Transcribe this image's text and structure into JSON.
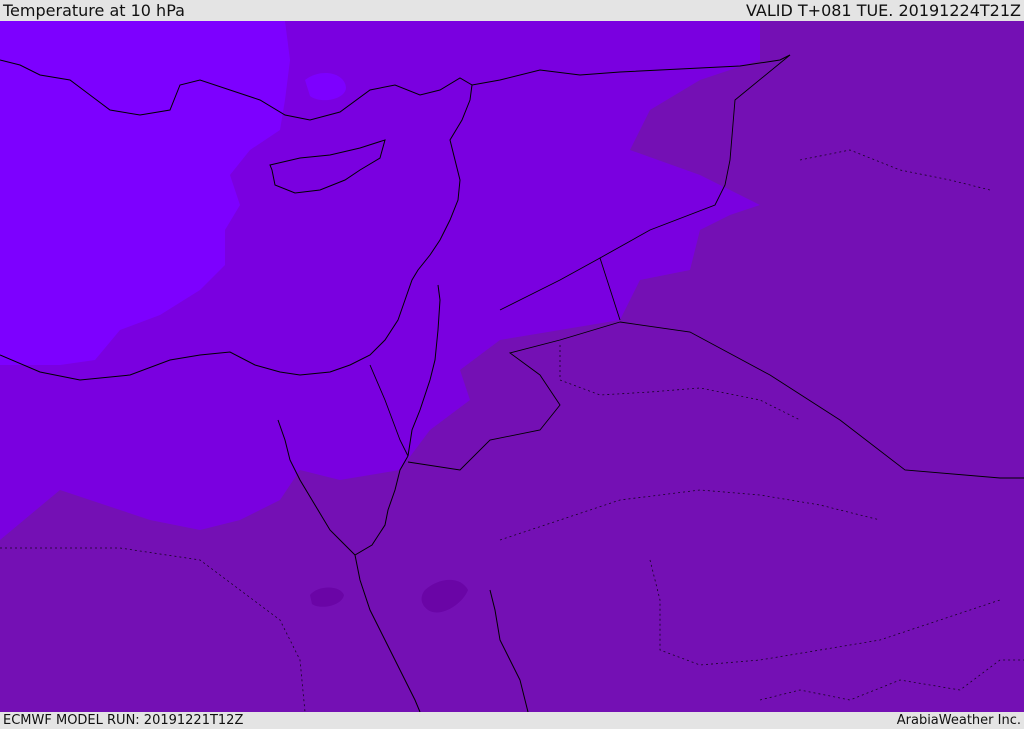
{
  "header": {
    "title": "Temperature at 10 hPa",
    "valid": "VALID T+081 TUE. 20191224T21Z"
  },
  "footer": {
    "model_run": "ECMWF MODEL RUN: 20191221T12Z",
    "credit": "ArabiaWeather Inc."
  },
  "colors": {
    "band_light": "#7d00ff",
    "band_mid": "#7a00e0",
    "band_dark": "#7410b4",
    "band_darkest": "#6a05a6",
    "coastline": "#000000",
    "bar_background": "#e4e4e4"
  }
}
